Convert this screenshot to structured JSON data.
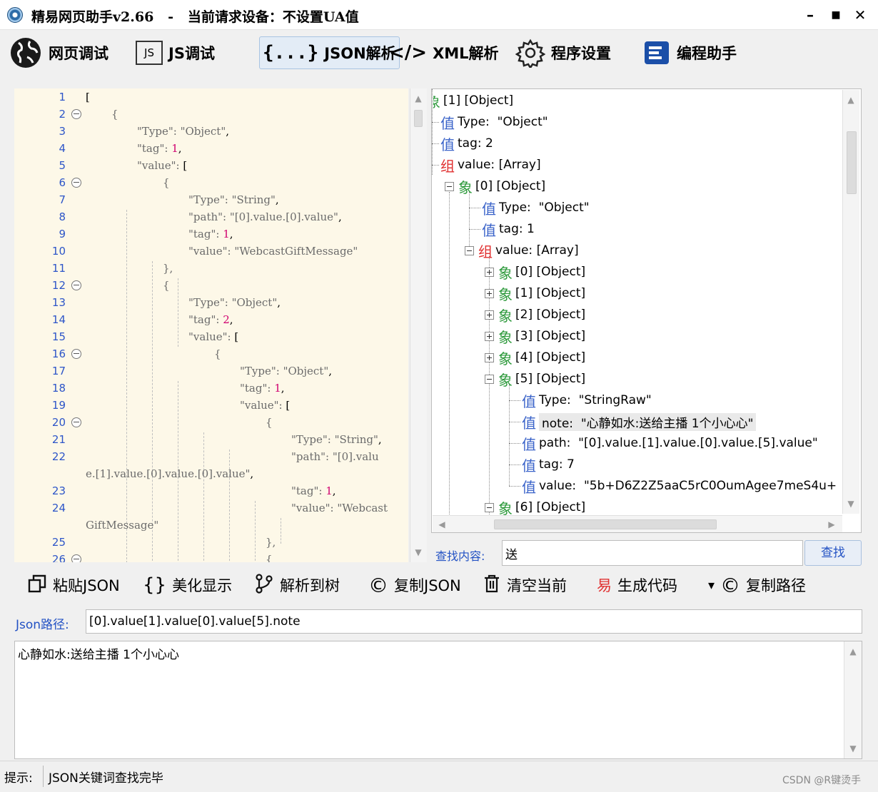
{
  "window": {
    "title": "精易网页助手v2.66   -   当前请求设备：不设置UA值",
    "controls": {
      "minimize": "–",
      "maximize": "■",
      "close": "✕"
    }
  },
  "toolbar": {
    "items": [
      {
        "label": "网页调试",
        "icon": "globe-icon"
      },
      {
        "label": "JS调试",
        "icon": "js-icon",
        "icon_text": "JS"
      },
      {
        "label": "JSON解析",
        "icon": "json-braces-icon",
        "icon_text": "{...}",
        "active": true
      },
      {
        "label": "XML解析",
        "icon": "code-tag-icon",
        "icon_text": "</>"
      },
      {
        "label": "程序设置",
        "icon": "gear-icon"
      },
      {
        "label": "编程助手",
        "icon": "assistant-icon"
      }
    ]
  },
  "editor": {
    "lines": [
      {
        "n": "1"
      },
      {
        "n": "2"
      },
      {
        "n": "3"
      },
      {
        "n": "4"
      },
      {
        "n": "5"
      },
      {
        "n": "6"
      },
      {
        "n": "7"
      },
      {
        "n": "8"
      },
      {
        "n": "9"
      },
      {
        "n": "10"
      },
      {
        "n": "11"
      },
      {
        "n": "12"
      },
      {
        "n": "13"
      },
      {
        "n": "14"
      },
      {
        "n": "15"
      },
      {
        "n": "16"
      },
      {
        "n": "17"
      },
      {
        "n": "18"
      },
      {
        "n": "19"
      },
      {
        "n": "20"
      },
      {
        "n": "21"
      },
      {
        "n": "22"
      },
      {
        "n": ""
      },
      {
        "n": "23"
      },
      {
        "n": "24"
      },
      {
        "n": ""
      },
      {
        "n": "25"
      },
      {
        "n": "26"
      }
    ],
    "code": {
      "l1": "[",
      "l2": "{",
      "l3k": "\"Type\": \"Object\"",
      "l3p": ",",
      "l4k": "\"tag\": ",
      "l4n": "1",
      "l4p": ",",
      "l5k": "\"value\": ",
      "l5p": "[",
      "l6": "{",
      "l7k": "\"Type\": \"String\"",
      "l7p": ",",
      "l8k": "\"path\": \"[0].value.[0].value\"",
      "l8p": ",",
      "l9k": "\"tag\": ",
      "l9n": "1",
      "l9p": ",",
      "l10k": "\"value\": \"WebcastGiftMessage\"",
      "l11": "},",
      "l12": "{",
      "l13k": "\"Type\": \"Object\"",
      "l13p": ",",
      "l14k": "\"tag\": ",
      "l14n": "2",
      "l14p": ",",
      "l15k": "\"value\": ",
      "l15p": "[",
      "l16": "{",
      "l17k": "\"Type\": \"Object\"",
      "l17p": ",",
      "l18k": "\"tag\": ",
      "l18n": "1",
      "l18p": ",",
      "l19k": "\"value\": ",
      "l19p": "[",
      "l20": "{",
      "l21k": "\"Type\": \"String\"",
      "l21p": ",",
      "l22k": "\"path\": \"[0].valu",
      "l22bk": "e.[1].value.[0].value.[0].value\"",
      "l22bp": ",",
      "l23k": "\"tag\": ",
      "l23n": "1",
      "l23p": ",",
      "l24k": "\"value\": \"Webcast",
      "l24bk": "GiftMessage\"",
      "l25": "},",
      "l26": "{"
    }
  },
  "tree": {
    "nodes": [
      {
        "badge": "象",
        "kind": "obj",
        "text": "[1] [Object]"
      },
      {
        "badge": "值",
        "kind": "val",
        "text": "Type:  \"Object\""
      },
      {
        "badge": "值",
        "kind": "val",
        "text": "tag: 2"
      },
      {
        "badge": "组",
        "kind": "arr",
        "text": "value: [Array]"
      },
      {
        "badge": "象",
        "kind": "obj",
        "text": "[0] [Object]"
      },
      {
        "badge": "值",
        "kind": "val",
        "text": "Type:  \"Object\""
      },
      {
        "badge": "值",
        "kind": "val",
        "text": "tag: 1"
      },
      {
        "badge": "组",
        "kind": "arr",
        "text": "value: [Array]"
      },
      {
        "badge": "象",
        "kind": "obj",
        "text": "[0] [Object]"
      },
      {
        "badge": "象",
        "kind": "obj",
        "text": "[1] [Object]"
      },
      {
        "badge": "象",
        "kind": "obj",
        "text": "[2] [Object]"
      },
      {
        "badge": "象",
        "kind": "obj",
        "text": "[3] [Object]"
      },
      {
        "badge": "象",
        "kind": "obj",
        "text": "[4] [Object]"
      },
      {
        "badge": "象",
        "kind": "obj",
        "text": "[5] [Object]"
      },
      {
        "badge": "值",
        "kind": "val",
        "text": "Type:  \"StringRaw\""
      },
      {
        "badge": "值",
        "kind": "val",
        "text": "note:  \"心静如水:送给主播 1个小心心\"",
        "selected": true
      },
      {
        "badge": "值",
        "kind": "val",
        "text": "path:  \"[0].value.[1].value.[0].value.[5].value\""
      },
      {
        "badge": "值",
        "kind": "val",
        "text": "tag: 7"
      },
      {
        "badge": "值",
        "kind": "val",
        "text": "value:  \"5b+D6Z2Z5aaC5rC0OumAgee7meS4u+"
      },
      {
        "badge": "象",
        "kind": "obj",
        "text": "[6] [Object]"
      }
    ]
  },
  "search": {
    "label": "查找内容:",
    "value": "送",
    "button": "查找"
  },
  "actions": [
    {
      "label": "粘贴JSON",
      "icon": "paste-icon"
    },
    {
      "label": "美化显示",
      "icon": "braces-icon",
      "icon_text": "{}"
    },
    {
      "label": "解析到树",
      "icon": "branch-icon"
    },
    {
      "label": "复制JSON",
      "icon": "copyright-icon",
      "icon_text": "©"
    },
    {
      "label": "清空当前",
      "icon": "trash-icon"
    },
    {
      "label": "生成代码",
      "icon": "yi-icon",
      "icon_text": "易"
    },
    {
      "label": "复制路径",
      "icon": "copyright-icon",
      "icon_text": "©",
      "dropdown": "▾"
    }
  ],
  "path": {
    "label": "Json路径:",
    "value": "[0].value[1].value[0].value[5].note"
  },
  "output": {
    "text": "心静如水:送给主播 1个小心心"
  },
  "status": {
    "label": "提示:",
    "text": "JSON关键词查找完毕"
  },
  "watermark": "CSDN @R键烫手",
  "colors": {
    "accent": "#2352c4",
    "editor_bg": "#fdf8e8",
    "number": "#d0006f",
    "badge_val": "#3a63c9",
    "badge_obj": "#2e9a3c",
    "badge_arr": "#e03030"
  }
}
